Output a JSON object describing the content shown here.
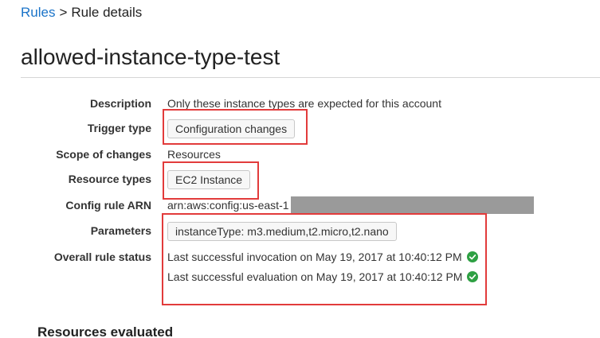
{
  "breadcrumb": {
    "parent": "Rules",
    "separator": ">",
    "current": "Rule details"
  },
  "page_title": "allowed-instance-type-test",
  "details": {
    "description": {
      "label": "Description",
      "value": "Only these instance types are expected for this account"
    },
    "trigger_type": {
      "label": "Trigger type",
      "value": "Configuration changes"
    },
    "scope": {
      "label": "Scope of changes",
      "value": "Resources"
    },
    "resource_types": {
      "label": "Resource types",
      "value": "EC2 Instance"
    },
    "arn": {
      "label": "Config rule ARN",
      "value": "arn:aws:config:us-east-1"
    },
    "parameters": {
      "label": "Parameters",
      "value": "instanceType: m3.medium,t2.micro,t2.nano"
    },
    "status": {
      "label": "Overall rule status",
      "invocation": "Last successful invocation on May 19, 2017 at 10:40:12 PM",
      "evaluation": "Last successful evaluation on May 19, 2017 at 10:40:12 PM"
    }
  },
  "resources_heading": "Resources evaluated",
  "colors": {
    "link": "#1a73c8",
    "highlight_box": "#e23b3b",
    "success": "#2ea043",
    "redaction": "#9a9a9a"
  },
  "icons": {
    "status_ok": "check-circle-icon"
  }
}
